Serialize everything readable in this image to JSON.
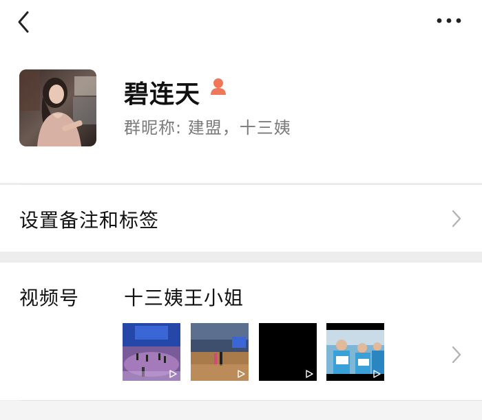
{
  "header": {
    "back_icon": "chevron-left-icon",
    "more_icon": "more-horizontal-icon"
  },
  "profile": {
    "name": "碧连天",
    "gender_icon": "female-icon",
    "gender_color": "#f0775a",
    "nickname_line": "群昵称: 建盟，十三姨"
  },
  "remark": {
    "label": "设置备注和标签"
  },
  "channel": {
    "label": "视频号",
    "name": "十三姨王小姐",
    "thumbnails": [
      {
        "kind": "dance-stage-show"
      },
      {
        "kind": "dance-floor-audience"
      },
      {
        "kind": "black-frame"
      },
      {
        "kind": "group-photo-outdoor"
      }
    ]
  },
  "colors": {
    "background": "#ededed",
    "card": "#ffffff",
    "secondary_text": "#7a7a7a",
    "chevron": "#b3b3b3"
  }
}
